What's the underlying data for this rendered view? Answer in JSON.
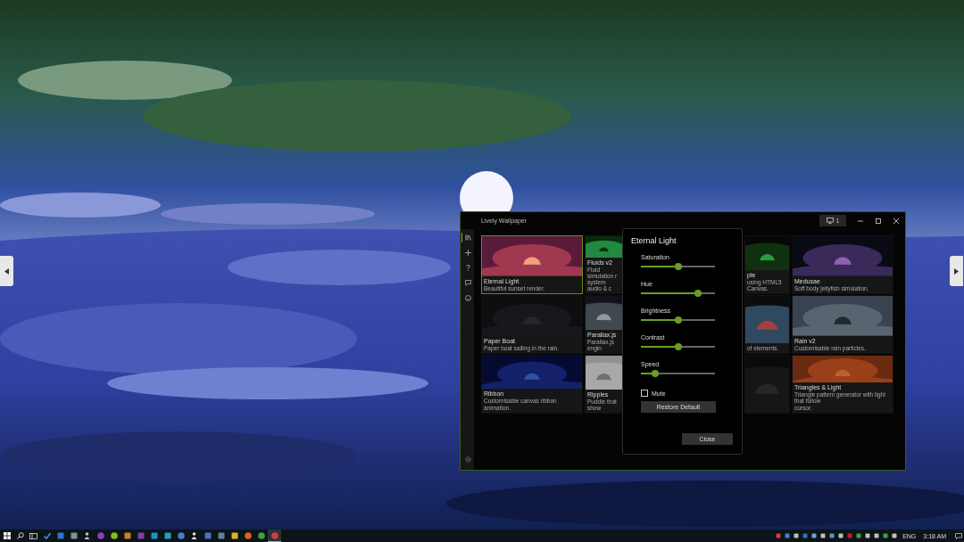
{
  "window": {
    "title": "Lively Wallpaper",
    "monitor_count": "1"
  },
  "sidebar": {
    "items": [
      {
        "kind": "library",
        "selected": true
      },
      {
        "kind": "add",
        "selected": false
      },
      {
        "kind": "help",
        "selected": false
      },
      {
        "kind": "chat",
        "selected": false
      },
      {
        "kind": "emoji",
        "selected": false
      }
    ],
    "settings": {
      "kind": "settings"
    }
  },
  "cards": [
    {
      "title": "Eternal Light",
      "description_lines": [
        "Beautiful sunset render."
      ],
      "selected": true
    },
    {
      "title": "Fluids v2",
      "description_lines": [
        "Fluid simulation r",
        "system audio & c"
      ],
      "selected": false
    },
    {
      "title": "ple",
      "description_lines": [
        "using HTML5 Canvas."
      ],
      "selected": false
    },
    {
      "title": "Medusae",
      "description_lines": [
        "Soft body jellyfish simulation."
      ],
      "selected": false
    },
    {
      "title": "Paper Boat",
      "description_lines": [
        "Paper boat sailing in the rain."
      ],
      "selected": false
    },
    {
      "title": "Parallax.js",
      "description_lines": [
        "Parallax.js engin"
      ],
      "selected": false
    },
    {
      "description_lines": [
        "of elements."
      ],
      "selected": false
    },
    {
      "title": "Rain v2",
      "description_lines": [
        "Customisable rain particles."
      ],
      "selected": false
    },
    {
      "title": "Ribbon",
      "description_lines": [
        "Customisable canvas ribbon animation."
      ],
      "selected": false
    },
    {
      "title": "Ripples",
      "description_lines": [
        "Puddle that show"
      ],
      "selected": false
    },
    {
      "selected": false
    },
    {
      "title": "Triangles & Light",
      "description_lines": [
        "Triangle pattern generator with light that follow",
        "cursor."
      ],
      "selected": false
    }
  ],
  "dialog": {
    "title": "Eternal Light",
    "sliders": [
      {
        "label": "Saturation",
        "level": 0.5
      },
      {
        "label": "Hue",
        "level": 0.77
      },
      {
        "label": "Brightness",
        "level": 0.5
      },
      {
        "label": "Contrast",
        "level": 0.5
      },
      {
        "label": "Speed",
        "level": 0.19
      }
    ],
    "mute": {
      "label": "Mute",
      "checked": false
    },
    "restore_button": "Restore Default",
    "close_button": "Close"
  },
  "taskbar": {
    "language": "ENG",
    "time": "3:18 AM"
  }
}
